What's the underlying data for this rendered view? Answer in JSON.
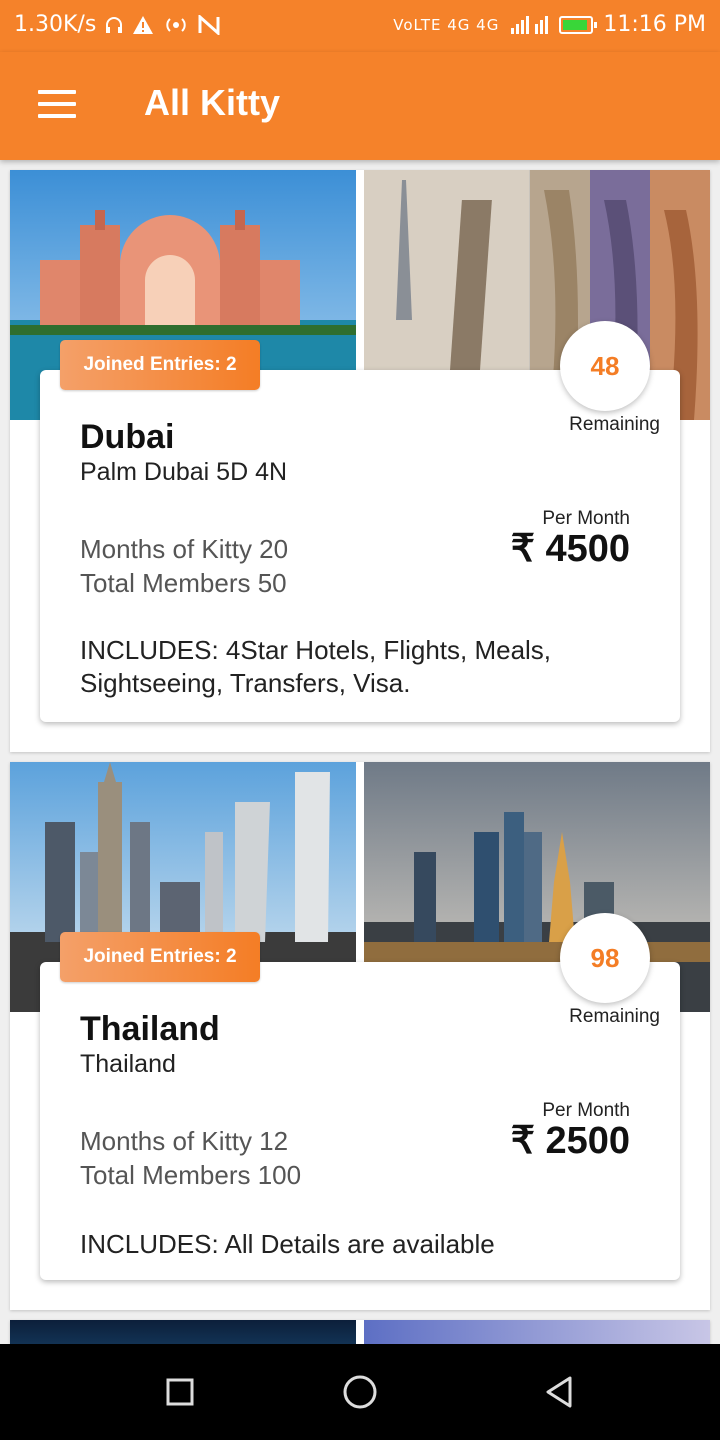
{
  "status_bar": {
    "speed": "1.30K/s",
    "network_label": "VoLTE 4G 4G",
    "time": "11:16 PM",
    "icons": [
      "headphones-icon",
      "warning-icon",
      "hotspot-icon",
      "n-icon",
      "signal-icon",
      "battery-icon"
    ]
  },
  "app_bar": {
    "title": "All Kitty",
    "menu_icon": "hamburger-menu-icon"
  },
  "kitties": [
    {
      "joined": "Joined Entries: 2",
      "remaining_count": "48",
      "remaining_label": "Remaining",
      "title": "Dubai",
      "subtitle": "Palm Dubai 5D 4N",
      "months": "Months of Kitty 20",
      "members": "Total Members 50",
      "per_month_label": "Per Month",
      "price": "₹ 4500",
      "includes": "INCLUDES: 4Star Hotels, Flights, Meals, Sightseeing, Transfers, Visa."
    },
    {
      "joined": "Joined Entries: 2",
      "remaining_count": "98",
      "remaining_label": "Remaining",
      "title": "Thailand",
      "subtitle": "Thailand",
      "months": "Months of Kitty 12",
      "members": "Total Members 100",
      "per_month_label": "Per Month",
      "price": "₹ 2500",
      "includes": "INCLUDES: All Details are available"
    }
  ],
  "nav_bar": {
    "icons": [
      "recents-square-icon",
      "home-circle-icon",
      "back-triangle-icon"
    ]
  },
  "colors": {
    "accent": "#f5822a",
    "badge": "#f47d25"
  }
}
